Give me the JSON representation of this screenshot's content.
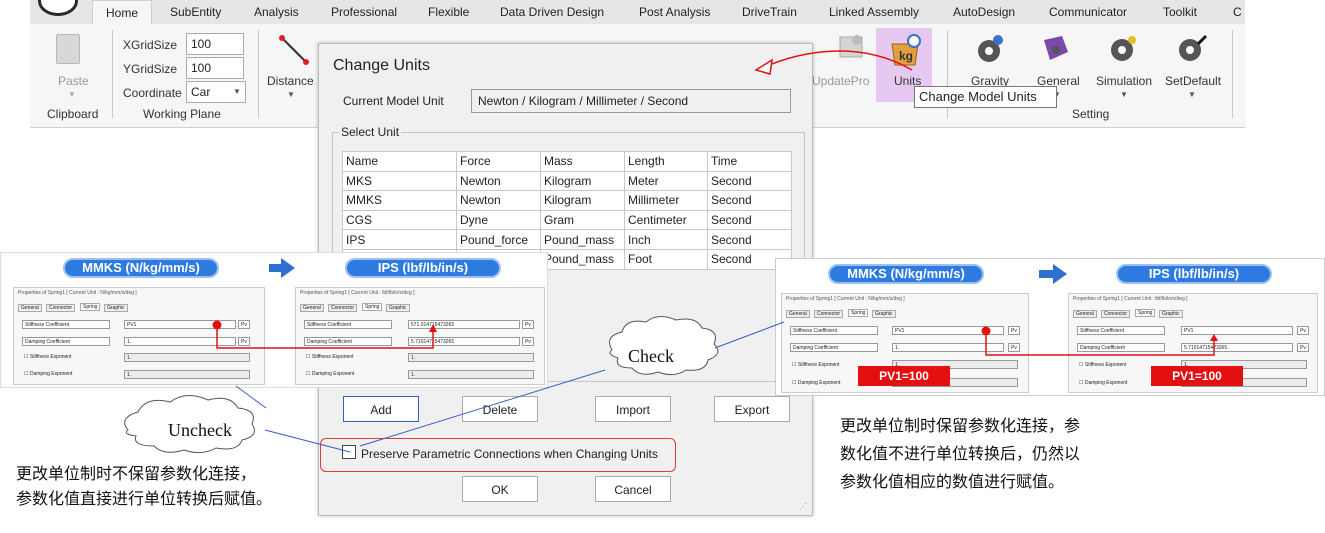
{
  "ribbon": {
    "tabs": [
      "SubEntity",
      "Analysis",
      "Professional",
      "Flexible",
      "Data Driven Design",
      "Post Analysis",
      "DriveTrain",
      "Linked Assembly",
      "AutoDesign",
      "Communicator",
      "Toolkit",
      "C"
    ],
    "home_tab": "Home",
    "clipboard": {
      "paste": "Paste",
      "group": "Clipboard"
    },
    "working_plane": {
      "xgrid_label": "XGridSize",
      "xgrid_value": "100",
      "ygrid_label": "YGridSize",
      "ygrid_value": "100",
      "coord_label": "Coordinate",
      "coord_value": "Car",
      "group": "Working Plane"
    },
    "distance": "Distance",
    "update_pro": "UpdatePro",
    "units": "Units",
    "setting": {
      "gravity": "Gravity",
      "general": "General",
      "simulation": "Simulation",
      "setdefault": "SetDefault",
      "group": "Setting"
    },
    "tooltip": "Change Model Units"
  },
  "dialog": {
    "title": "Change Units",
    "current_label": "Current Model Unit",
    "current_value": "Newton / Kilogram / Millimeter / Second",
    "select_label": "Select Unit",
    "columns": [
      "Name",
      "Force",
      "Mass",
      "Length",
      "Time"
    ],
    "rows": [
      [
        "MKS",
        "Newton",
        "Kilogram",
        "Meter",
        "Second"
      ],
      [
        "MMKS",
        "Newton",
        "Kilogram",
        "Millimeter",
        "Second"
      ],
      [
        "CGS",
        "Dyne",
        "Gram",
        "Centimeter",
        "Second"
      ],
      [
        "IPS",
        "Pound_force",
        "Pound_mass",
        "Inch",
        "Second"
      ],
      [
        "",
        "",
        "Pound_mass",
        "Foot",
        "Second"
      ]
    ],
    "buttons": {
      "add": "Add",
      "delete": "Delete",
      "import": "Import",
      "export": "Export",
      "ok": "OK",
      "cancel": "Cancel"
    },
    "preserve_label": "Preserve Parametric Connections when Changing Units"
  },
  "left_panel": {
    "mmks_pill": "MMKS (N/kg/mm/s)",
    "ips_pill": "IPS (lbf/lb/in/s)",
    "mmks_props_title": "Properties of Spring1 [ Current Unit : N/kg/mm/s/deg ]",
    "ips_props_title": "Properties of Spring1 [ Current Unit : lbf/lb/in/s/deg ]",
    "tabs": [
      "General",
      "Connector",
      "Spring",
      "Graphic"
    ],
    "stiffness": "Stiffness Coefficient",
    "damping": "Damping Coefficient",
    "stiff_exp": "Stiffness Exponent",
    "damp_exp": "Damping Exponent",
    "pv": "Pv",
    "mmks_values": [
      "PV1",
      "1.",
      "1.",
      "1."
    ],
    "ips_values": [
      "571.014715473265",
      "5.71014715473265",
      "1.",
      "1."
    ]
  },
  "right_panel": {
    "mmks_pill": "MMKS (N/kg/mm/s)",
    "ips_pill": "IPS (lbf/lb/in/s)",
    "mmks_props_title": "Properties of Spring1 [ Current Unit : N/kg/mm/s/deg ]",
    "ips_props_title": "Properties of Spring1 [ Current Unit : lbf/lb/in/s/deg ]",
    "mmks_values": [
      "PV1",
      "1.",
      "1.",
      "1."
    ],
    "ips_values": [
      "PV1",
      "5.71014715473265",
      "1.",
      "1."
    ],
    "pv1_left": "PV1=100",
    "pv1_right": "PV1=100"
  },
  "callouts": {
    "check": "Check",
    "uncheck": "Uncheck",
    "left_note_1": "更改单位制时不保留参数化连接，",
    "left_note_2": "参数化值直接进行单位转换后赋值。",
    "right_note_1": "更改单位制时保留参数化连接，参",
    "right_note_2": "数化值不进行单位转换后，仍然以",
    "right_note_3": "参数化值相应的数值进行赋值。"
  },
  "colors": {
    "accent": "#2e7be0",
    "red": "#e21010",
    "units_highlight": "#e6c8f0"
  }
}
